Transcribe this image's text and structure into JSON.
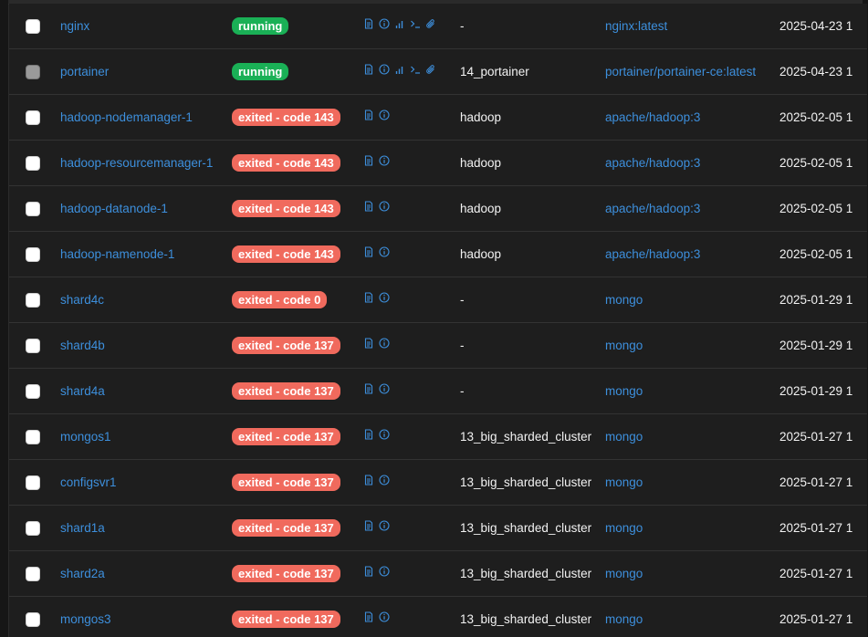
{
  "colors": {
    "running": "#1ab056",
    "exited": "#f06a5d"
  },
  "rows": [
    {
      "name": "nginx",
      "state": "running",
      "state_kind": "running",
      "actions": [
        "logs-icon",
        "inspect-icon",
        "stats-icon",
        "console-icon",
        "attach-icon"
      ],
      "stack": "-",
      "image": "nginx:latest",
      "created": "2025-04-23 1",
      "checkbox_disabled": false
    },
    {
      "name": "portainer",
      "state": "running",
      "state_kind": "running",
      "actions": [
        "logs-icon",
        "inspect-icon",
        "stats-icon",
        "console-icon",
        "attach-icon"
      ],
      "stack": "14_portainer",
      "image": "portainer/portainer-ce:latest",
      "created": "2025-04-23 1",
      "checkbox_disabled": true
    },
    {
      "name": "hadoop-nodemanager-1",
      "state": "exited - code 143",
      "state_kind": "exited",
      "actions": [
        "logs-icon",
        "inspect-icon"
      ],
      "stack": "hadoop",
      "image": "apache/hadoop:3",
      "created": "2025-02-05 1",
      "checkbox_disabled": false
    },
    {
      "name": "hadoop-resourcemanager-1",
      "state": "exited - code 143",
      "state_kind": "exited",
      "actions": [
        "logs-icon",
        "inspect-icon"
      ],
      "stack": "hadoop",
      "image": "apache/hadoop:3",
      "created": "2025-02-05 1",
      "checkbox_disabled": false
    },
    {
      "name": "hadoop-datanode-1",
      "state": "exited - code 143",
      "state_kind": "exited",
      "actions": [
        "logs-icon",
        "inspect-icon"
      ],
      "stack": "hadoop",
      "image": "apache/hadoop:3",
      "created": "2025-02-05 1",
      "checkbox_disabled": false
    },
    {
      "name": "hadoop-namenode-1",
      "state": "exited - code 143",
      "state_kind": "exited",
      "actions": [
        "logs-icon",
        "inspect-icon"
      ],
      "stack": "hadoop",
      "image": "apache/hadoop:3",
      "created": "2025-02-05 1",
      "checkbox_disabled": false
    },
    {
      "name": "shard4c",
      "state": "exited - code 0",
      "state_kind": "exited",
      "actions": [
        "logs-icon",
        "inspect-icon"
      ],
      "stack": "-",
      "image": "mongo",
      "created": "2025-01-29 1",
      "checkbox_disabled": false
    },
    {
      "name": "shard4b",
      "state": "exited - code 137",
      "state_kind": "exited",
      "actions": [
        "logs-icon",
        "inspect-icon"
      ],
      "stack": "-",
      "image": "mongo",
      "created": "2025-01-29 1",
      "checkbox_disabled": false
    },
    {
      "name": "shard4a",
      "state": "exited - code 137",
      "state_kind": "exited",
      "actions": [
        "logs-icon",
        "inspect-icon"
      ],
      "stack": "-",
      "image": "mongo",
      "created": "2025-01-29 1",
      "checkbox_disabled": false
    },
    {
      "name": "mongos1",
      "state": "exited - code 137",
      "state_kind": "exited",
      "actions": [
        "logs-icon",
        "inspect-icon"
      ],
      "stack": "13_big_sharded_cluster",
      "image": "mongo",
      "created": "2025-01-27 1",
      "checkbox_disabled": false
    },
    {
      "name": "configsvr1",
      "state": "exited - code 137",
      "state_kind": "exited",
      "actions": [
        "logs-icon",
        "inspect-icon"
      ],
      "stack": "13_big_sharded_cluster",
      "image": "mongo",
      "created": "2025-01-27 1",
      "checkbox_disabled": false
    },
    {
      "name": "shard1a",
      "state": "exited - code 137",
      "state_kind": "exited",
      "actions": [
        "logs-icon",
        "inspect-icon"
      ],
      "stack": "13_big_sharded_cluster",
      "image": "mongo",
      "created": "2025-01-27 1",
      "checkbox_disabled": false
    },
    {
      "name": "shard2a",
      "state": "exited - code 137",
      "state_kind": "exited",
      "actions": [
        "logs-icon",
        "inspect-icon"
      ],
      "stack": "13_big_sharded_cluster",
      "image": "mongo",
      "created": "2025-01-27 1",
      "checkbox_disabled": false
    },
    {
      "name": "mongos3",
      "state": "exited - code 137",
      "state_kind": "exited",
      "actions": [
        "logs-icon",
        "inspect-icon"
      ],
      "stack": "13_big_sharded_cluster",
      "image": "mongo",
      "created": "2025-01-27 1",
      "checkbox_disabled": false
    }
  ]
}
